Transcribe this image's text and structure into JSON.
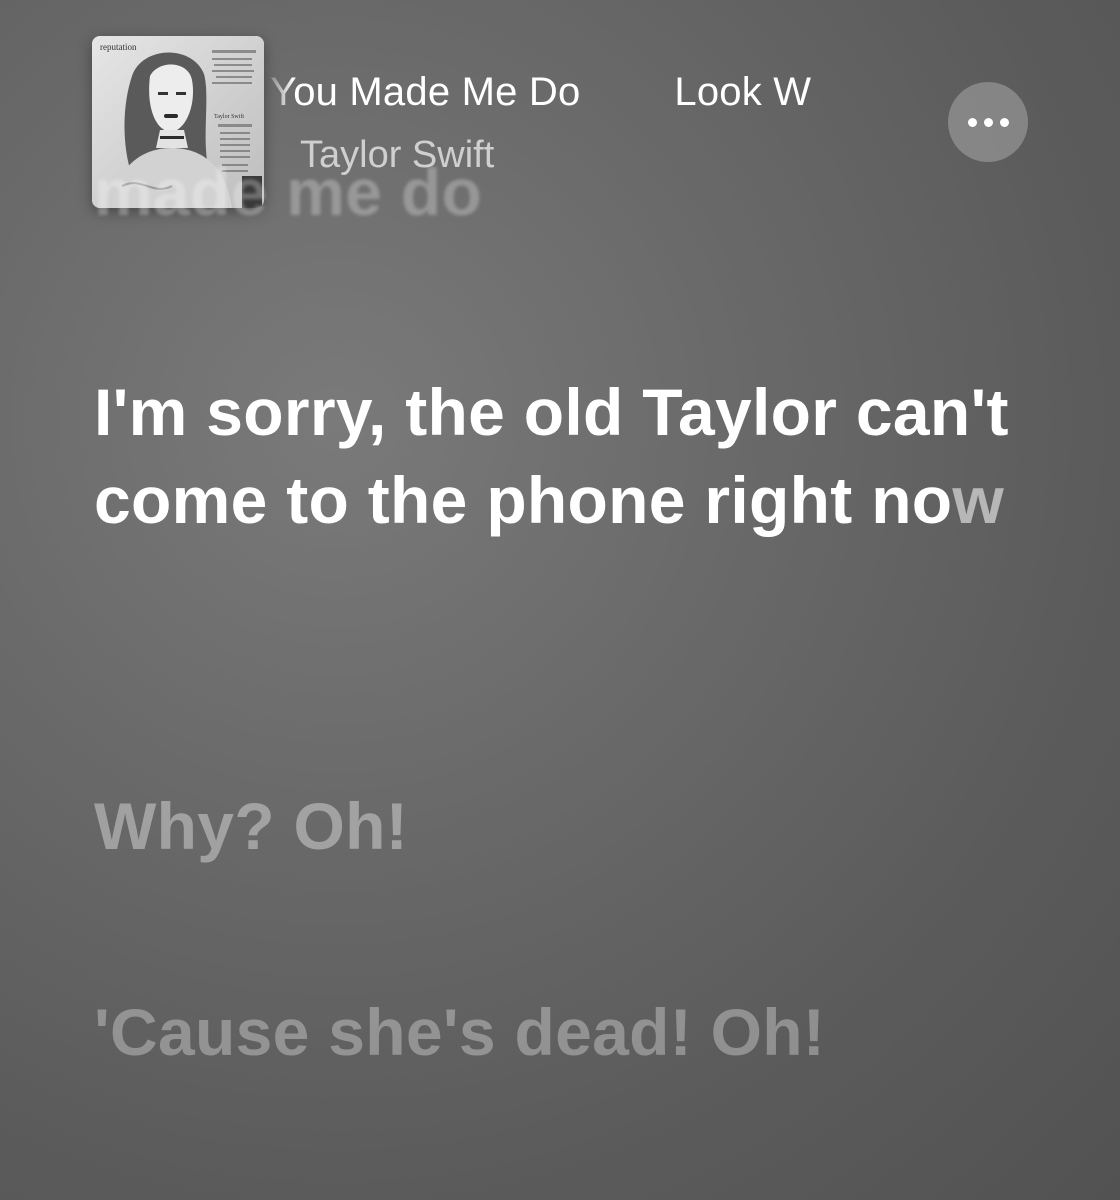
{
  "now_playing": {
    "title": "You Made Me Do",
    "next_title": "Look W",
    "artist": "Taylor Swift",
    "album_art": {
      "album_label": "reputation",
      "name_fragment": "Taylor Swift"
    }
  },
  "more_button": {
    "icon": "ellipsis-icon"
  },
  "lyrics": {
    "previous_line": "made me do",
    "current_line_main": "I'm sorry, the old Taylor can't come to the phone right no",
    "current_line_tail": "w",
    "next_line": "Why? Oh!",
    "following_line": "'Cause she's dead! Oh!"
  },
  "colors": {
    "background": "#666666",
    "current_lyric": "#ffffff",
    "inactive_lyric": "#9a9a9a",
    "artist_text": "#cfcfcf"
  }
}
